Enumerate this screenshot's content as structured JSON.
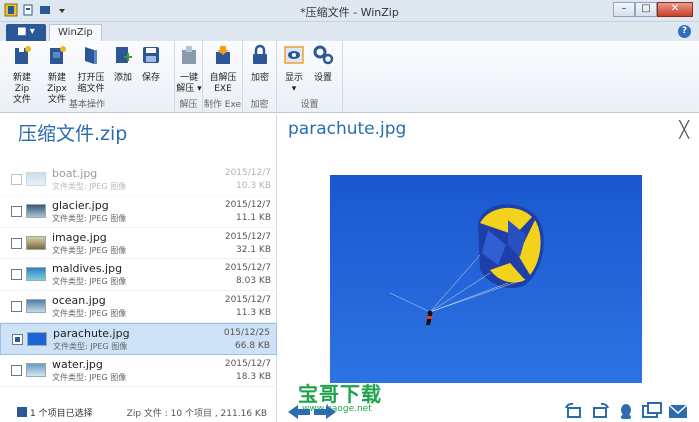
{
  "window": {
    "title": "*压缩文件 - WinZip",
    "minimize": "–",
    "maximize": "□",
    "close": "✕"
  },
  "tabs": {
    "file_label": "■ ▾",
    "winzip_tab": "WinZip",
    "help": "?"
  },
  "ribbon": {
    "groups": [
      {
        "label": "基本操作",
        "buttons": [
          {
            "name": "new-zip-button",
            "icon": "new-zip-icon",
            "lines": [
              "新建Zip",
              "文件"
            ]
          },
          {
            "name": "new-zipx-button",
            "icon": "new-zipx-icon",
            "lines": [
              "新建Zipx",
              "文件"
            ]
          },
          {
            "name": "open-zip-button",
            "icon": "open-zip-icon",
            "lines": [
              "打开压",
              "缩文件"
            ]
          },
          {
            "name": "add-button",
            "icon": "add-file-icon",
            "lines": [
              "添加"
            ]
          },
          {
            "name": "save-button",
            "icon": "save-icon",
            "lines": [
              "保存"
            ]
          }
        ]
      },
      {
        "label": "解压",
        "buttons": [
          {
            "name": "one-click-unzip-button",
            "icon": "unzip-icon",
            "lines": [
              "一键",
              "解压 ▾"
            ]
          }
        ]
      },
      {
        "label": "制作 Exe",
        "buttons": [
          {
            "name": "self-extract-exe-button",
            "icon": "exe-icon",
            "lines": [
              "自解压",
              "EXE"
            ]
          }
        ]
      },
      {
        "label": "加密",
        "buttons": [
          {
            "name": "encrypt-button",
            "icon": "lock-icon",
            "lines": [
              "加密"
            ]
          }
        ]
      },
      {
        "label": "设置",
        "buttons": [
          {
            "name": "display-button",
            "icon": "eye-icon",
            "lines": [
              "显示",
              "▾"
            ]
          },
          {
            "name": "settings-button",
            "icon": "gear-icon",
            "lines": [
              "设置"
            ]
          }
        ]
      }
    ]
  },
  "archive": {
    "name": "压缩文件.zip"
  },
  "files": [
    {
      "name": "boat.jpg",
      "type": "文件类型: JPEG 图像",
      "date": "2015/12/7",
      "size": "10.3 KB",
      "faded": true,
      "selected": false
    },
    {
      "name": "glacier.jpg",
      "type": "文件类型: JPEG 图像",
      "date": "2015/12/7",
      "size": "11.1 KB",
      "faded": false,
      "selected": false
    },
    {
      "name": "image.jpg",
      "type": "文件类型: JPEG 图像",
      "date": "2015/12/7",
      "size": "32.1 KB",
      "faded": false,
      "selected": false
    },
    {
      "name": "maldives.jpg",
      "type": "文件类型: JPEG 图像",
      "date": "2015/12/7",
      "size": "8.03 KB",
      "faded": false,
      "selected": false
    },
    {
      "name": "ocean.jpg",
      "type": "文件类型: JPEG 图像",
      "date": "2015/12/7",
      "size": "11.3 KB",
      "faded": false,
      "selected": false
    },
    {
      "name": "parachute.jpg",
      "type": "文件类型: JPEG 图像",
      "date": "015/12/25",
      "size": "66.8 KB",
      "faded": false,
      "selected": true
    },
    {
      "name": "water.jpg",
      "type": "文件类型: JPEG 图像",
      "date": "2015/12/7",
      "size": "18.3 KB",
      "faded": false,
      "selected": false
    }
  ],
  "status": {
    "selected": "1 个项目已选择",
    "summary": "Zip 文件 : 10 个项目 , 211.16 KB"
  },
  "preview": {
    "filename": "parachute.jpg",
    "close": "╳"
  },
  "watermark": {
    "main": "宝哥下载",
    "url": "www.baoge.net"
  },
  "colors": {
    "accent": "#2b6cb0",
    "selection": "#cde1f7",
    "sky": "#1f63d8",
    "watermark": "#1fa34a"
  }
}
